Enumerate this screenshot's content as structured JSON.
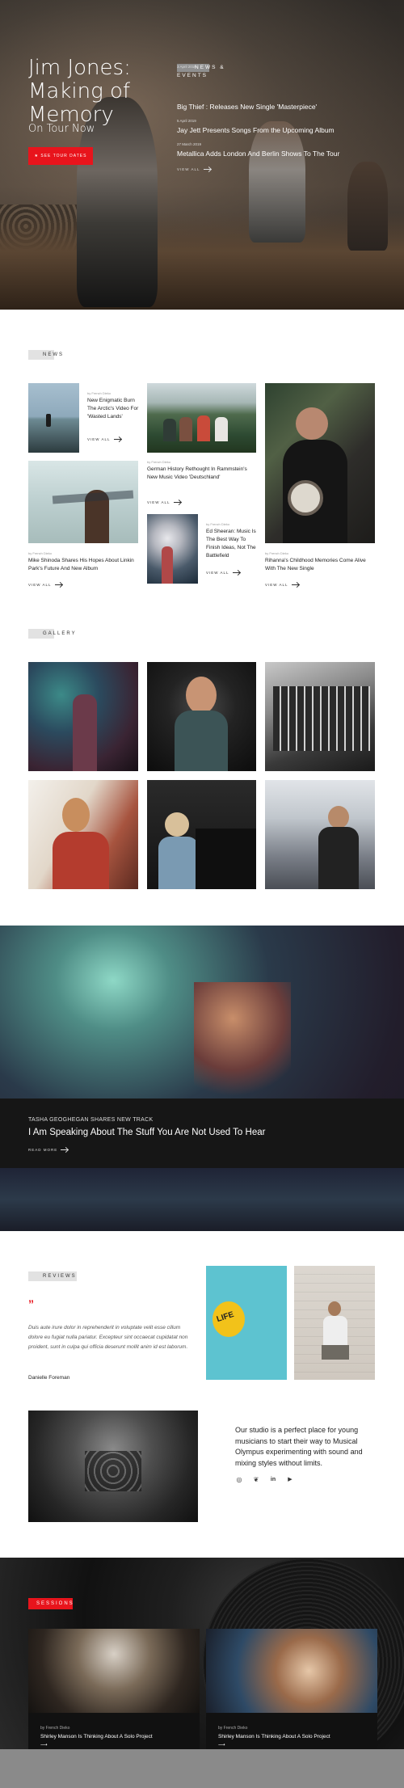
{
  "hero": {
    "title": "Jim Jones: Making of Memory",
    "subtitle": "On Tour Now",
    "button_label": "★ See Tour Dates",
    "news_events_label": "NEWS & EVENTS",
    "events": [
      {
        "date": "3 April 2019",
        "title": "Big Thief : Releases New Single 'Masterpiece'"
      },
      {
        "date": "5 April 2019",
        "title": "Jay Jett Presents Songs From the Upcoming Album"
      },
      {
        "date": "27 March 2019",
        "title": "Metallica Adds London And Berlin Shows To The Tour"
      }
    ],
    "view_all": "VIEW ALL"
  },
  "news": {
    "label": "NEWS",
    "items": [
      {
        "meta": "by French Dieko",
        "title": "New Enigmatic Burn The Arctic's Video For 'Wasted Lands'",
        "view": "VIEW ALL"
      },
      {
        "meta": "by French Dieko",
        "title": "German History Rethought In Rammstein's New Music Video 'Deutschland'",
        "view": "VIEW ALL"
      },
      {
        "meta": "by French Dieko",
        "title": "Mike Shinoda Shares His Hopes About Linkin Park's Future And New Album",
        "view": "VIEW ALL"
      },
      {
        "meta": "by French Dieko",
        "title": "Ed Sheeran: Music Is The Best Way To Finish Ideas, Not The Battlefield",
        "view": "VIEW ALL"
      },
      {
        "meta": "by French Dieko",
        "title": "Rihanna's Childhood Memories Come Alive With The New Single",
        "view": "VIEW ALL"
      }
    ]
  },
  "gallery": {
    "label": "GALLERY"
  },
  "banner": {
    "small": "TASHA GEOGHEGAN SHARES NEW TRACK",
    "title": "I Am Speaking About The Stuff You Are Not Used To Hear",
    "read_more": "READ MORE"
  },
  "reviews": {
    "label": "REVIEWS",
    "quote_mark": "”",
    "text": "Duis aute irure dolor in reprehenderit in voluptate velit esse cillum dolore eu fugiat nulla pariatur. Excepteur sint occaecat cupidatat non proident, sunt in culpa qui officia deserunt mollit anim id est laborum.",
    "author": "Danielle Foreman",
    "balloon_text": "LIFE"
  },
  "studio": {
    "text": "Our studio is a perfect place for young musicians to start their way to Musical Olympus experimenting with sound and mixing styles without limits.",
    "social": [
      "instagram-icon",
      "twitter-icon",
      "linkedin-icon",
      "youtube-icon"
    ],
    "social_glyphs": [
      "◎",
      "❦",
      "in",
      "▶"
    ]
  },
  "sessions": {
    "label": "SESSIONS",
    "cards": [
      {
        "meta": "by French Dieko",
        "title": "Shirley Manson Is Thinking About A Solo Project",
        "arrow": "⟶"
      },
      {
        "meta": "by French Dieko",
        "title": "Shirley Manson Is Thinking About A Solo Project",
        "arrow": "⟶"
      }
    ]
  },
  "colors": {
    "accent": "#e8141c"
  }
}
